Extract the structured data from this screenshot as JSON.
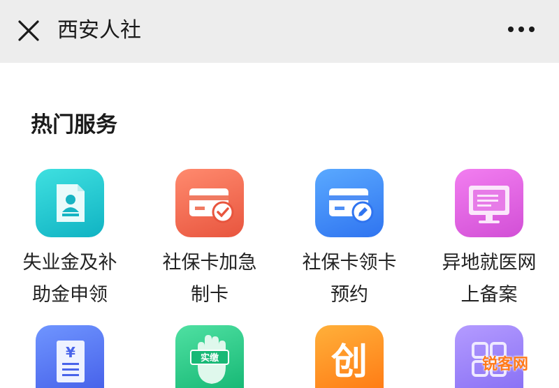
{
  "header": {
    "title": "西安人社",
    "close_icon": "close-icon",
    "more_icon": "more-dots-icon"
  },
  "hot_services": {
    "title": "热门服务",
    "items": [
      {
        "line1": "失业金及补",
        "line2": "助金申领",
        "icon": "document-person-icon",
        "color": "#1fc2cf"
      },
      {
        "line1": "社保卡加急",
        "line2": "制卡",
        "icon": "card-check-icon",
        "color": "#ef6a50"
      },
      {
        "line1": "社保卡领卡",
        "line2": "预约",
        "icon": "card-edit-icon",
        "color": "#3d8af7"
      },
      {
        "line1": "异地就医网",
        "line2": "上备案",
        "icon": "monitor-icon",
        "color": "#de5fe0"
      }
    ],
    "row2": [
      {
        "icon": "yuan-document-icon",
        "color": "#5a79f5"
      },
      {
        "icon": "hand-badge-icon",
        "badge": "实缴",
        "color": "#2bcc8b"
      },
      {
        "icon": "chuang-icon",
        "glyph": "创",
        "color": "#ff9326"
      },
      {
        "icon": "grid-icon",
        "color": "#9d85fa"
      }
    ]
  },
  "watermark": "锐客网"
}
